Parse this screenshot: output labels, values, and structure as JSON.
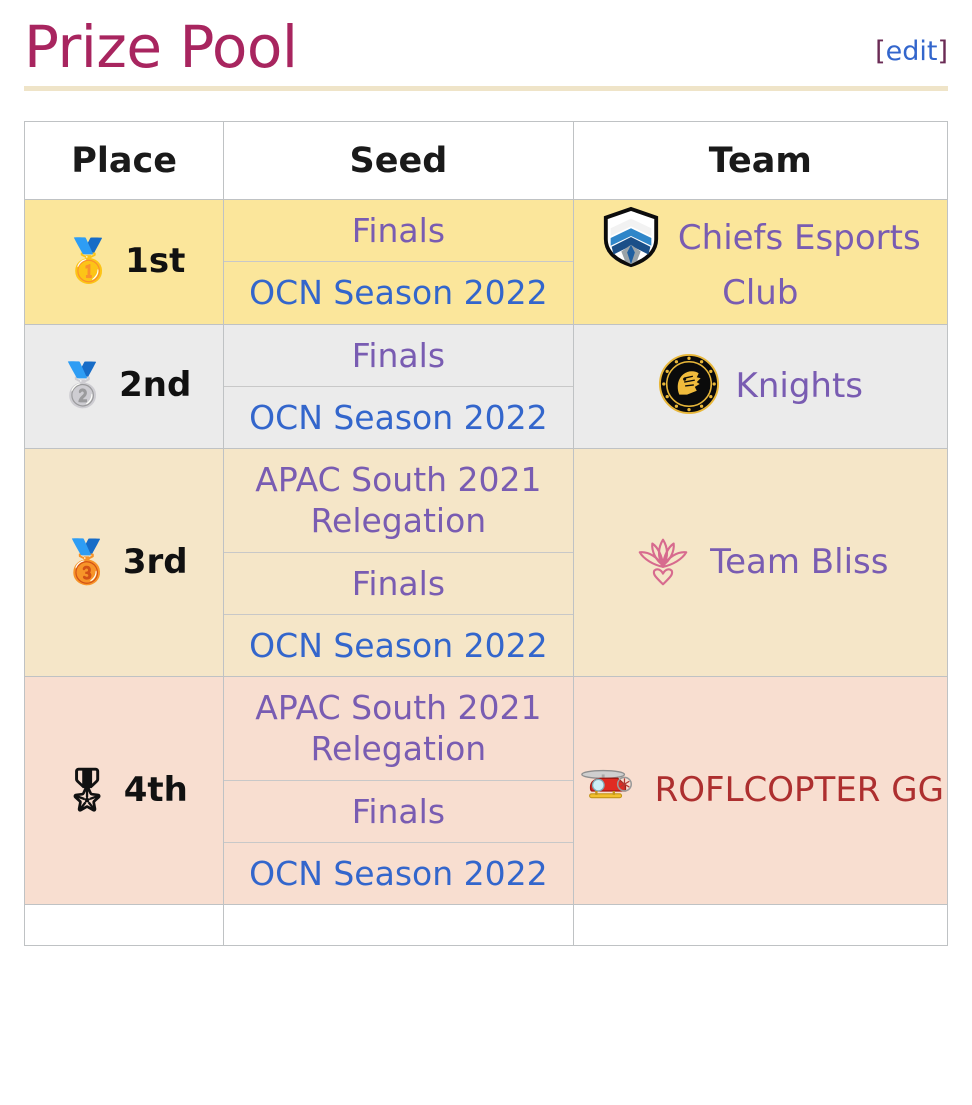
{
  "header": {
    "title": "Prize Pool",
    "edit_label": "edit",
    "edit_bracket_open": "[",
    "edit_bracket_close": "]",
    "title_color": "#a8255f",
    "rule_color": "#efe4c8"
  },
  "table": {
    "columns": [
      "Place",
      "Seed",
      "Team"
    ],
    "rows": [
      {
        "place": "1st",
        "medal_icon": "gold-medal-icon",
        "medal_glyph": "🥇",
        "row_color": "#fbe69b",
        "seeds": [
          {
            "label": "Finals",
            "state": "visited"
          },
          {
            "label": "OCN Season 2022",
            "state": "unvisited"
          }
        ],
        "team": {
          "name": "Chiefs Esports Club",
          "logo_icon": "chiefs-esports-club-logo",
          "link_state": "visited"
        }
      },
      {
        "place": "2nd",
        "medal_icon": "silver-medal-icon",
        "medal_glyph": "🥈",
        "row_color": "#ebebeb",
        "seeds": [
          {
            "label": "Finals",
            "state": "visited"
          },
          {
            "label": "OCN Season 2022",
            "state": "unvisited"
          }
        ],
        "team": {
          "name": "Knights",
          "logo_icon": "knights-logo",
          "link_state": "visited"
        }
      },
      {
        "place": "3rd",
        "medal_icon": "bronze-medal-icon",
        "medal_glyph": "🥉",
        "row_color": "#f5e6c8",
        "seeds": [
          {
            "label": "APAC South 2021 Relegation",
            "state": "visited"
          },
          {
            "label": "Finals",
            "state": "visited"
          },
          {
            "label": "OCN Season 2022",
            "state": "unvisited"
          }
        ],
        "team": {
          "name": "Team Bliss",
          "logo_icon": "team-bliss-lotus-logo",
          "link_state": "visited"
        }
      },
      {
        "place": "4th",
        "medal_icon": "copper-medal-icon",
        "medal_glyph": "🎖",
        "row_color": "#f8ded0",
        "seeds": [
          {
            "label": "APAC South 2021 Relegation",
            "state": "visited"
          },
          {
            "label": "Finals",
            "state": "visited"
          },
          {
            "label": "OCN Season 2022",
            "state": "unvisited"
          }
        ],
        "team": {
          "name": "ROFLCOPTER GG",
          "logo_icon": "roflcopter-helicopter-logo",
          "link_state": "redlink"
        }
      }
    ]
  },
  "colors": {
    "link": "#3366cc",
    "link_visited": "#795cb2",
    "link_new": "#ad2f2f",
    "border": "#bfc2c4",
    "inner_divider": "#c8c8c8"
  }
}
